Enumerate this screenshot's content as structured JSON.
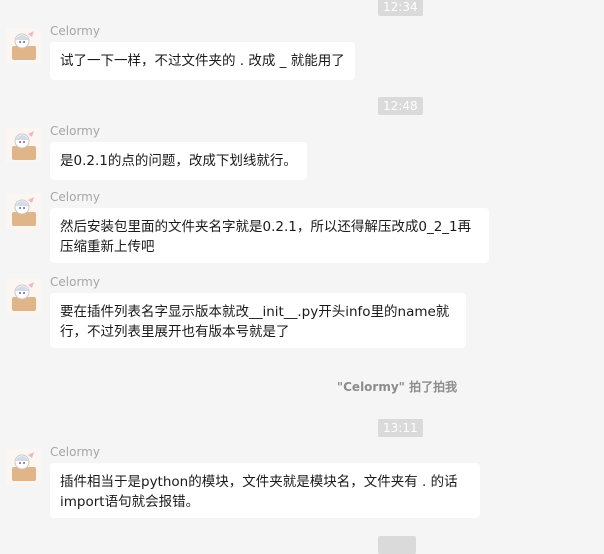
{
  "timestamps": [
    "12:34",
    "12:48",
    "13:11",
    ""
  ],
  "messages": [
    {
      "sender": "Celormy",
      "text": "试了一下一样，不过文件夹的 . 改成 _ 就能用了"
    },
    {
      "sender": "Celormy",
      "text": "是0.2.1的点的问题，改成下划线就行。"
    },
    {
      "sender": "Celormy",
      "text": "然后安装包里面的文件夹名字就是0.2.1，所以还得解压改成0_2_1再压缩重新上传吧"
    },
    {
      "sender": "Celormy",
      "text": "要在插件列表名字显示版本就改__init__.py开头info里的name就行，不过列表里展开也有版本号就是了"
    },
    {
      "sender": "Celormy",
      "text": "插件相当于是python的模块，文件夹就是模块名，文件夹有 . 的话import语句就会报错。"
    }
  ],
  "system_notice": "\"Celormy\" 拍了拍我",
  "avatar_icon": "anime-girl-avatar-icon"
}
